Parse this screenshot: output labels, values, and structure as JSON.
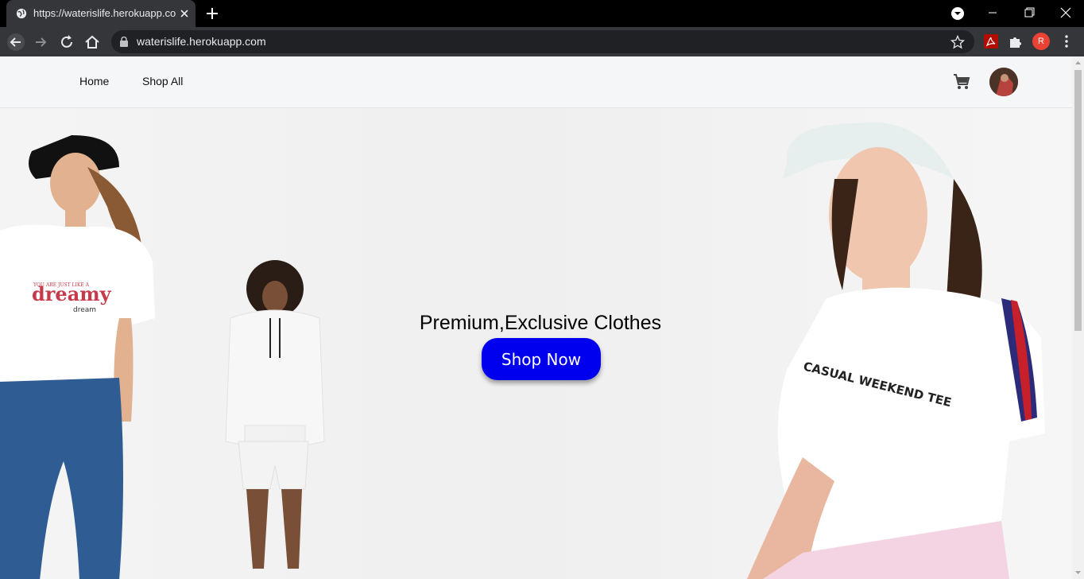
{
  "browser": {
    "tab_title": "https://waterislife.herokuapp.com",
    "url": "waterislife.herokuapp.com",
    "profile_initial": "R",
    "icons": [
      "globe-icon",
      "close-icon",
      "plus-icon",
      "tab-search-icon",
      "minimize-icon",
      "restore-icon",
      "close-window-icon",
      "back-icon",
      "forward-icon",
      "reload-icon",
      "home-icon",
      "lock-icon",
      "star-icon",
      "pdf-extension-icon",
      "puzzle-icon",
      "menu-icon"
    ]
  },
  "nav": {
    "home_label": "Home",
    "shop_all_label": "Shop All",
    "icons": [
      "cart-icon"
    ]
  },
  "hero": {
    "headline": "Premium,Exclusive Clothes",
    "cta_label": "Shop Now",
    "cta_color": "#0000ee",
    "model1_shirt_small": "YOU ARE JUST LIKE A",
    "model1_shirt_big": "dreamy",
    "model1_shirt_sub": "dream",
    "model3_shirt": "CASUAL WEEKEND TEE"
  }
}
